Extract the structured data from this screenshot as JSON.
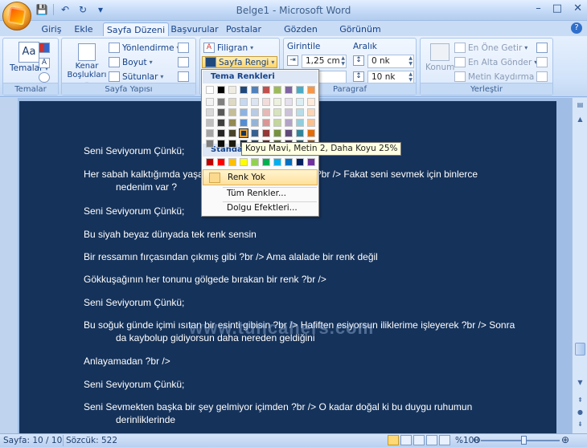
{
  "title_bar": {
    "title": "Belge1 - Microsoft Word",
    "minimize": "–",
    "maximize": "□",
    "close": "✕"
  },
  "quick_access": {
    "save": "💾",
    "undo": "↶",
    "redo": "↻",
    "more": "▾"
  },
  "tabs": [
    "Giriş",
    "Ekle",
    "Sayfa Düzeni",
    "Başvurular",
    "Postalar",
    "Gözden Geçir",
    "Görünüm"
  ],
  "active_tab": "Sayfa Düzeni",
  "ribbon": {
    "themes": {
      "label": "Temalar",
      "button": "Temalar"
    },
    "page_setup": {
      "label": "Sayfa Yapısı",
      "margins": "Kenar Boşlukları",
      "orientation": "Yönlendirme",
      "size": "Boyut",
      "columns": "Sütunlar"
    },
    "page_background": {
      "watermark": "Filigran",
      "page_color": "Sayfa Rengi"
    },
    "paragraph": {
      "label": "Paragraf",
      "indent_label": "Girintile",
      "indent_left": "1,25 cm",
      "spacing_label": "Aralık",
      "spacing_before": "0 nk",
      "spacing_after": "10 nk"
    },
    "arrange": {
      "label": "Yerleştir",
      "position": "Konum",
      "bring_front": "En Öne Getir",
      "send_back": "En Alta Gönder",
      "text_wrap": "Metin Kaydırma"
    }
  },
  "page_color_menu": {
    "theme_colors_header": "Tema Renkleri",
    "standard_colors_header": "Standart",
    "no_color": "Renk Yok",
    "more_colors": "Tüm Renkler...",
    "fill_effects": "Dolgu Efektleri...",
    "tooltip": "Koyu Mavi, Metin 2, Daha Koyu 25%",
    "selected_color": "#1f497d",
    "theme_top_row": [
      "#ffffff",
      "#000000",
      "#eeece1",
      "#1f497d",
      "#4f81bd",
      "#c0504d",
      "#9bbb59",
      "#8064a2",
      "#4bacc6",
      "#f79646"
    ],
    "theme_shades": [
      [
        "#f2f2f2",
        "#7f7f7f",
        "#ddd9c3",
        "#c6d9f0",
        "#dbe5f1",
        "#f2dcdb",
        "#ebf1dd",
        "#e5e0ec",
        "#dbeef3",
        "#fdeada"
      ],
      [
        "#d8d8d8",
        "#595959",
        "#c4bd97",
        "#8db3e2",
        "#b8cce4",
        "#e5b9b7",
        "#d7e3bc",
        "#ccc1d9",
        "#b7dde8",
        "#fbd5b5"
      ],
      [
        "#bfbfbf",
        "#3f3f3f",
        "#938953",
        "#548dd4",
        "#95b3d7",
        "#d99694",
        "#c3d69b",
        "#b2a2c7",
        "#92cddc",
        "#fac08f"
      ],
      [
        "#a5a5a5",
        "#262626",
        "#494429",
        "#17365d",
        "#366092",
        "#953734",
        "#76923c",
        "#5f497a",
        "#31859b",
        "#e36c09"
      ],
      [
        "#7f7f7f",
        "#0c0c0c",
        "#1d1b10",
        "#0f243e",
        "#244061",
        "#632423",
        "#4f6128",
        "#3f3151",
        "#205867",
        "#974806"
      ]
    ],
    "standard_colors": [
      "#c00000",
      "#ff0000",
      "#ffc000",
      "#ffff00",
      "#92d050",
      "#00b050",
      "#00b0f0",
      "#0070c0",
      "#002060",
      "#7030a0"
    ]
  },
  "document": {
    "page_color": "#15325a",
    "paragraphs": [
      {
        "text": "Seni Seviyorum Çünkü;"
      },
      {
        "text": "Her sabah kalktığımda yaşamaya",
        "tail": "n ?br /> Fakat seni sevmek için binlerce",
        "cont": "nedenim var ?"
      },
      {
        "text": "Seni Seviyorum Çünkü;"
      },
      {
        "text": "Bu siyah beyaz dünyada tek renk sensin"
      },
      {
        "text": "Bir ressamın fırçasından çıkmış gibi ?br /> Ama alalade bir renk değil"
      },
      {
        "text": "Gökkuşağının her tonunu gölgede bırakan bir renk ?br />"
      },
      {
        "text": "Seni Seviyorum Çünkü;"
      },
      {
        "text": "Bu soğuk günde içimi ısıtan bir esinti gibisin ?br /> Hafiften esiyorsun iliklerime işleyerek ?br /> Sonra",
        "cont": "da kaybolup gidiyorsun daha nereden geldiğini"
      },
      {
        "text": "Anlayamadan ?br />"
      },
      {
        "text": "Seni Seviyorum Çünkü;"
      },
      {
        "text": "Seni Sevmekten başka bir şey gelmiyor içimden ?br /> O kadar doğal ki bu duygu ruhumun",
        "cont": "derinliklerinde"
      }
    ],
    "watermark_text": "www.tuncahers.com"
  },
  "status_bar": {
    "page": "Sayfa: 10 / 10",
    "words": "Sözcük: 522",
    "zoom": "%100",
    "zoom_level": 1.0
  }
}
